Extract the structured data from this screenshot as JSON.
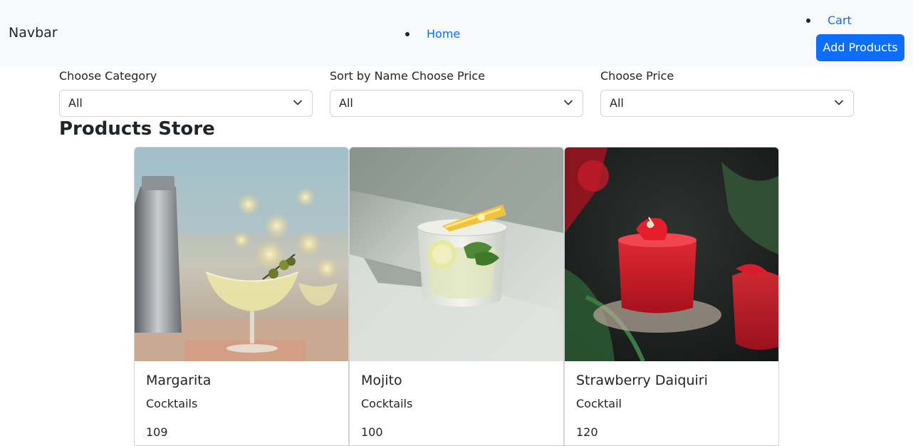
{
  "navbar": {
    "brand": "Navbar",
    "home_label": "Home",
    "cart_label": "Cart",
    "add_products_label": "Add Products",
    "link_color": "#0d6efd",
    "button_color": "#0d6efd"
  },
  "filters": [
    {
      "label": "Choose Category",
      "value": "All"
    },
    {
      "label": "Sort by Name Choose Price",
      "value": "All"
    },
    {
      "label": "Choose Price",
      "value": "All"
    }
  ],
  "page_title": "Products Store",
  "products": [
    {
      "name": "Margarita",
      "category": "Cocktails",
      "price": "109",
      "image": "margarita-photo"
    },
    {
      "name": "Mojito",
      "category": "Cocktails",
      "price": "100",
      "image": "mojito-photo"
    },
    {
      "name": "Strawberry Daiquiri",
      "category": "Cocktail",
      "price": "120",
      "image": "strawberry-daiquiri-photo"
    }
  ]
}
